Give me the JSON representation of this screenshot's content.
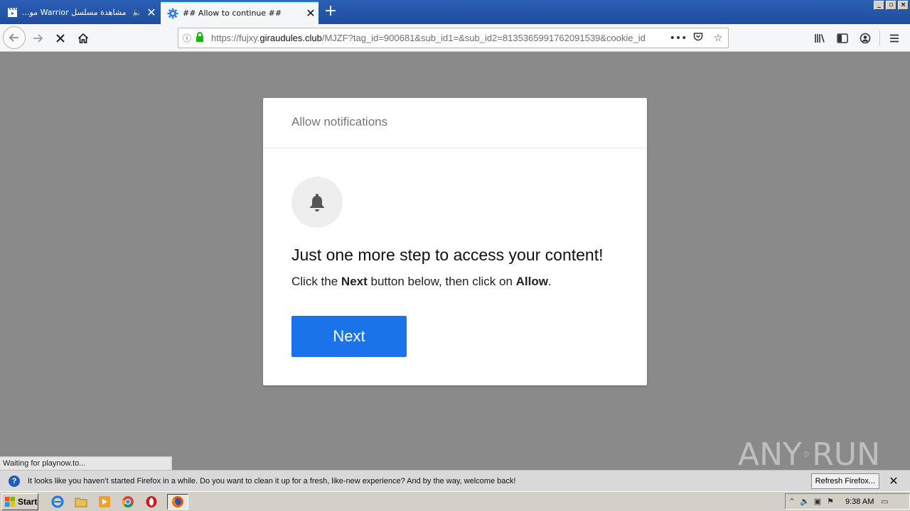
{
  "tabs": [
    {
      "label": "مشاهدة مسلسل Warrior مو...",
      "icon": "clapperboard-icon",
      "active": false
    },
    {
      "label": "## Allow to continue ##",
      "icon": "gear-icon",
      "active": true
    }
  ],
  "nav": {
    "url_prefix": "https://fujxy.",
    "url_domain": "giraudules.club",
    "url_rest": "/MJZF?tag_id=900681&sub_id1=&sub_id2=8135365991762091539&cookie_id"
  },
  "modal": {
    "header": "Allow notifications",
    "headline": "Just one more step to access your content!",
    "instruction_pre": "Click the ",
    "instruction_next": "Next",
    "instruction_mid": " button below, then click on ",
    "instruction_allow": "Allow",
    "instruction_post": ".",
    "next_button": "Next"
  },
  "status": "Waiting for playnow.to...",
  "watermark": {
    "left": "ANY",
    "right": "RUN"
  },
  "notification": {
    "message": "It looks like you haven’t started Firefox in a while. Do you want to clean it up for a fresh, like-new experience? And by the way, welcome back!",
    "refresh_button": "Refresh Firefox..."
  },
  "taskbar": {
    "start_label": "Start",
    "clock": "9:38 AM"
  },
  "colors": {
    "accent": "#1a73e8",
    "tabbar": "#2b5fb4",
    "overlay": "#8a8a8a"
  }
}
